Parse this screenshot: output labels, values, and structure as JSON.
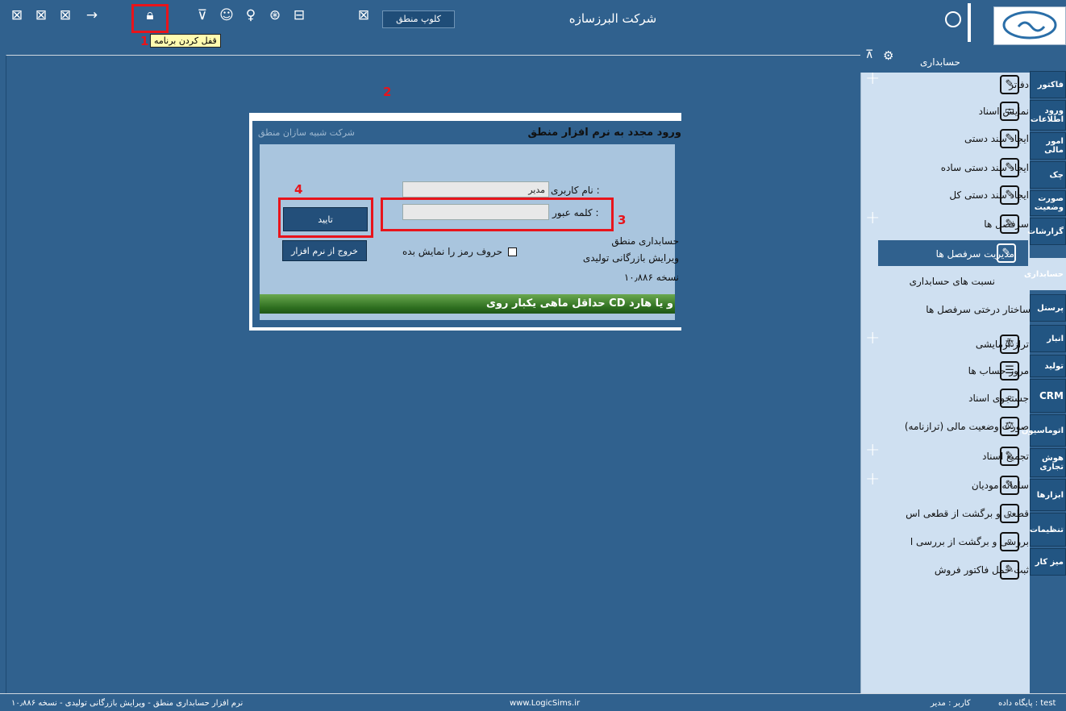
{
  "topbar": {
    "company_name": "شرکت البرزسازه",
    "club_button": "کلوپ منطق",
    "lock_tooltip": "قفل کردن برنامه",
    "icons": [
      "minimize-window-icon",
      "restore-window-icon",
      "cascade-window-icon",
      "arrow-right-icon",
      "lock-program-icon",
      "filter-icon",
      "user-search-icon",
      "bulb-icon",
      "theme-icon",
      "database-icon",
      "window-icon"
    ]
  },
  "annotations": {
    "n1": "1",
    "n2": "2",
    "n3": "3",
    "n4": "4"
  },
  "dialog": {
    "title": "ورود مجدد به نرم افزار منطق",
    "subtitle": "شرکت شبیه سازان منطق",
    "username_label": "نام کاربری :",
    "username_value": "مدیر",
    "password_label": "کلمه عبور :",
    "password_value": "",
    "product_name": "حسابداری منطق",
    "edition": "ویرایش بازرگانی تولیدی",
    "version": "نسخه ۱۰٫۸۸۶",
    "show_password_label": "حروف رمز را نمایش بده",
    "confirm_button": "تایید",
    "exit_button": "خروج از نرم افزار",
    "banner": "حداقل ماهی یکبار روی CD و یا هارد"
  },
  "right_panel": {
    "title": "حسابداری",
    "items": [
      {
        "label": "دفاتر",
        "icon": "folder-edit-icon",
        "plus": true
      },
      {
        "label": "نمایش اسناد",
        "icon": "folder-icon",
        "plus": false
      },
      {
        "label": "ایجاد سند دستی",
        "icon": "folder-edit-icon",
        "plus": false
      },
      {
        "label": "ایجاد سند دستی ساده",
        "icon": "folder-edit-icon",
        "plus": false
      },
      {
        "label": "ایجاد سند دستی کل",
        "icon": "folder-edit-icon",
        "plus": false
      },
      {
        "label": "سرفصل ها",
        "icon": "folder-edit-icon",
        "plus": true
      },
      {
        "label": "مدیریت سرفصل ها",
        "icon": "manage-headings-icon",
        "plus": false
      },
      {
        "label": "نسبت های حسابداری",
        "icon": "",
        "plus": false
      },
      {
        "label": "ساختار درختی سرفصل ها",
        "icon": "",
        "plus": false
      },
      {
        "label": "تراز آزمایشی",
        "icon": "scale-icon",
        "plus": true
      },
      {
        "label": "مرور حساب ها",
        "icon": "account-review-icon",
        "plus": false
      },
      {
        "label": "جستجوی اسناد",
        "icon": "search-document-icon",
        "plus": false
      },
      {
        "label": "صورت وضعیت مالی (ترازنامه)",
        "icon": "balance-sheet-icon",
        "plus": false
      },
      {
        "label": "تجمیع اسناد",
        "icon": "folder-edit-icon",
        "plus": true
      },
      {
        "label": "سامانه مودیان",
        "icon": "folder-edit-icon",
        "plus": true
      },
      {
        "label": "قطعی و برگشت از قطعی اس",
        "icon": "document-check-icon",
        "plus": false
      },
      {
        "label": "بررسی و برگشت از بررسی ا",
        "icon": "document-review-icon",
        "plus": false
      },
      {
        "label": "ثبت حمل فاکتور فروش",
        "icon": "clipboard-edit-icon",
        "plus": false
      }
    ]
  },
  "tabs": [
    "فاکتور",
    "ورود اطلاعات",
    "امور مالی",
    "چک",
    "صورت وضعیت",
    "گزارشات",
    "حسابداری",
    "پرسنل",
    "انبار",
    "تولید",
    "CRM",
    "اتوماسیون",
    "هوش تجاری",
    "ابزارها",
    "تنظیمات",
    "میز کار"
  ],
  "status": {
    "left": "نرم افزار حسابداری منطق - ویرایش بازرگانی تولیدی - نسخه ۱۰٫۸۸۶",
    "center": "www.LogicSims.ir",
    "user": "کاربر : مدیر",
    "db": "پایگاه داده : test"
  }
}
